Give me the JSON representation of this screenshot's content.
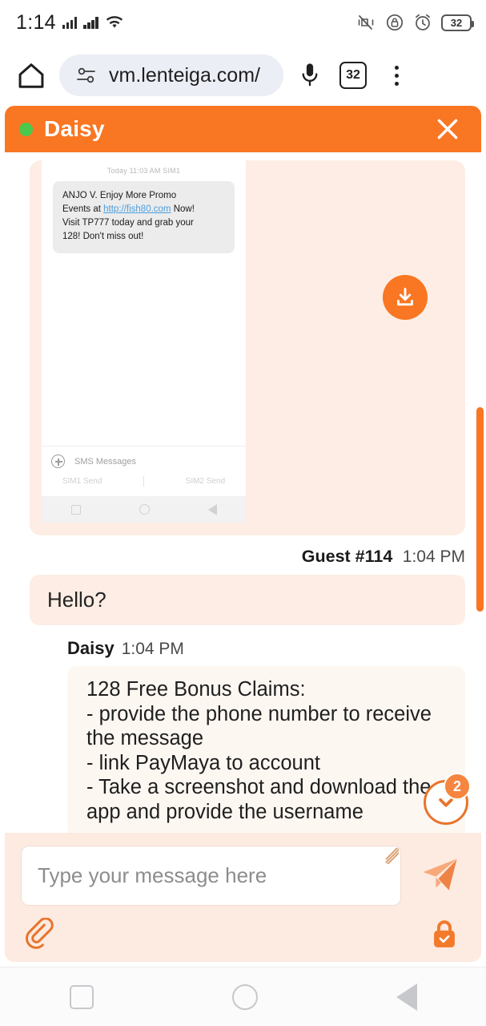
{
  "status_bar": {
    "time": "1:14",
    "battery_level": "32",
    "icons": [
      "signal-bars-sim1",
      "signal-bars-sim2",
      "wifi-icon",
      "vibrate-mute-icon",
      "screen-lock-icon",
      "alarm-icon",
      "battery-icon"
    ]
  },
  "browser": {
    "home_icon": "home-icon",
    "site_settings_icon": "tune-icon",
    "url": "vm.lenteiga.com/",
    "mic_icon": "microphone-icon",
    "tab_count": "32",
    "menu_icon": "overflow-menu-icon"
  },
  "chat": {
    "header": {
      "status": "online",
      "agent_name": "Daisy",
      "close_label": "✕"
    },
    "image_message": {
      "screenshot": {
        "timestamp": "Today 11:03 AM SIM1",
        "sms_line1": "ANJO V. Enjoy More Promo",
        "sms_line2_pre": "Events at ",
        "sms_link": "http://fish80.com",
        "sms_line2_post": " Now!",
        "sms_line3": "Visit TP777 today and grab your",
        "sms_line4": "128! Don't miss out!",
        "compose_label": "SMS Messages",
        "sim1_button": "SIM1 Send",
        "sim2_button": "SIM2 Send"
      },
      "download_icon": "download-icon"
    },
    "messages": [
      {
        "sender": "Guest #114",
        "time": "1:04 PM",
        "text": "Hello?",
        "side": "right"
      },
      {
        "sender": "Daisy",
        "time": "1:04 PM",
        "text": "128 Free Bonus Claims:\n- provide the phone number to receive the message\n- link PayMaya to account\n- Take a screenshot and download the app and provide the username",
        "side": "left"
      }
    ],
    "scroll_down": {
      "unread_count": "2",
      "icon": "chevron-down-icon"
    },
    "composer": {
      "placeholder": "Type your message here",
      "value": "",
      "send_icon": "send-paper-plane-icon",
      "attach_icon": "paperclip-icon",
      "secure_icon": "lock-icon"
    }
  },
  "android_nav": {
    "recents": "recents-square-icon",
    "home": "home-circle-icon",
    "back": "back-triangle-icon"
  },
  "colors": {
    "brand_orange": "#F97622",
    "bubble_peach": "#FDEDE4",
    "bubble_cream": "#FDF7F2",
    "composer_bg": "#FDEAE0",
    "online_green": "#4CC94C"
  }
}
